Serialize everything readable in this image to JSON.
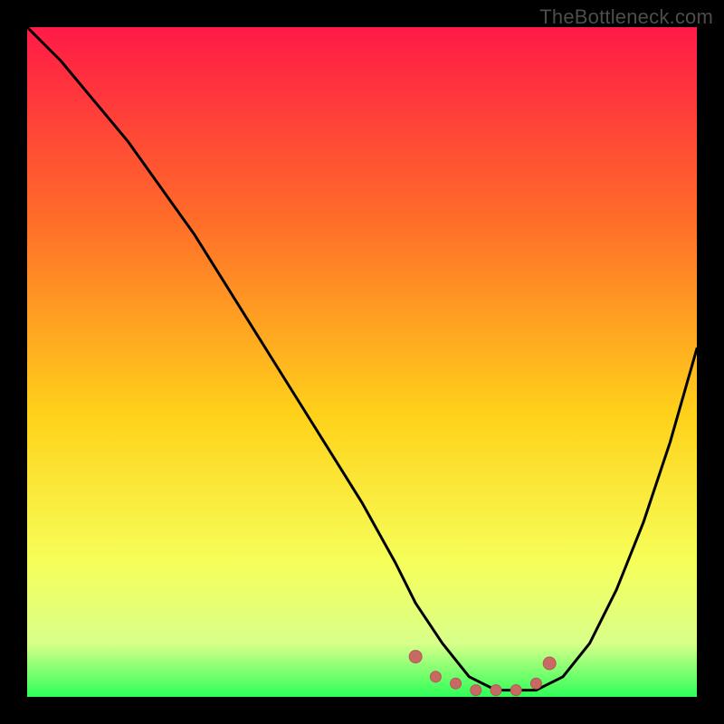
{
  "watermark": "TheBottleneck.com",
  "colors": {
    "frame": "#000000",
    "gradient_top": "#ff1a47",
    "gradient_upper_mid": "#ff6a2a",
    "gradient_mid": "#ffd21a",
    "gradient_lower_mid": "#f6ff5a",
    "gradient_low": "#d8ff8a",
    "gradient_base": "#2dff58",
    "curve": "#000000",
    "marker_fill": "#c66a63",
    "marker_stroke": "#b35a54"
  },
  "chart_data": {
    "type": "line",
    "title": "",
    "xlabel": "",
    "ylabel": "",
    "xlim": [
      0,
      100
    ],
    "ylim": [
      0,
      100
    ],
    "series": [
      {
        "name": "bottleneck-curve",
        "x": [
          0,
          5,
          10,
          15,
          20,
          25,
          30,
          35,
          40,
          45,
          50,
          55,
          58,
          62,
          66,
          70,
          72,
          76,
          80,
          84,
          88,
          92,
          96,
          100
        ],
        "y": [
          100,
          95,
          89,
          83,
          76,
          69,
          61,
          53,
          45,
          37,
          29,
          20,
          14,
          8,
          3,
          1,
          1,
          1,
          3,
          8,
          16,
          26,
          38,
          52
        ]
      }
    ],
    "markers": {
      "name": "flat-bottom-markers",
      "x": [
        58,
        61,
        64,
        67,
        70,
        73,
        76,
        78
      ],
      "y": [
        6,
        3,
        2,
        1,
        1,
        1,
        2,
        5
      ]
    },
    "grid": false,
    "legend": false,
    "notes": "V-shaped bottleneck curve on rainbow gradient; minimum around x≈68–72. Values estimated from pixels."
  }
}
